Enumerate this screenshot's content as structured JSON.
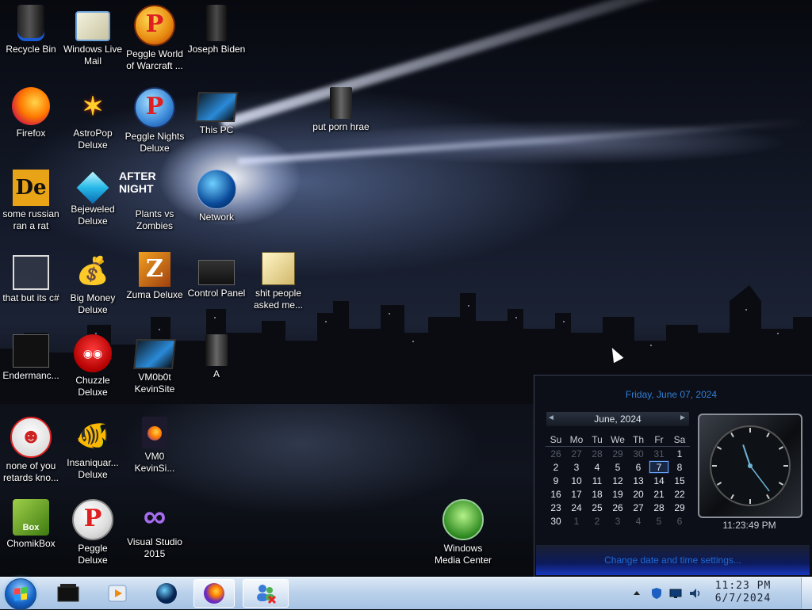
{
  "desktop_icons": [
    {
      "label": "Recycle Bin",
      "icon": "recycle-bin-icon"
    },
    {
      "label": "Windows Live Mail",
      "icon": "mail-icon"
    },
    {
      "label": "Peggle World of Warcraft ...",
      "icon": "peggle-icon"
    },
    {
      "label": "Joseph Biden",
      "icon": "user-folder-icon"
    },
    {
      "label": "Firefox",
      "icon": "firefox-icon"
    },
    {
      "label": "AstroPop Deluxe",
      "icon": "astropop-icon"
    },
    {
      "label": "Peggle Nights Deluxe",
      "icon": "peggle-nights-icon"
    },
    {
      "label": "This PC",
      "icon": "monitor-icon"
    },
    {
      "label": "put porn hrae",
      "icon": "document-icon"
    },
    {
      "label": "some russian ran a rat",
      "icon": "de-app-icon"
    },
    {
      "label": "Bejeweled Deluxe",
      "icon": "gem-icon"
    },
    {
      "label": "Plants vs Zombies",
      "icon": "plants-vs-zombies-icon"
    },
    {
      "label": "AFTER  NIGHT",
      "icon": "after-night-logo"
    },
    {
      "label": "Network",
      "icon": "network-globe-icon"
    },
    {
      "label": "that but its c#",
      "icon": "windows-stack-icon"
    },
    {
      "label": "Big Money Deluxe",
      "icon": "money-bag-icon"
    },
    {
      "label": "Zuma Deluxe",
      "icon": "zuma-icon"
    },
    {
      "label": "Control Panel",
      "icon": "control-panel-icon"
    },
    {
      "label": "shit people asked me...",
      "icon": "folder-icon"
    },
    {
      "label": "Endermanc...",
      "icon": "terminal-icon"
    },
    {
      "label": "Chuzzle Deluxe",
      "icon": "chuzzle-icon"
    },
    {
      "label": "VM0b0t KevinSite",
      "icon": "vm-icon"
    },
    {
      "label": "A",
      "icon": "file-icon"
    },
    {
      "label": "none of you retards kno...",
      "icon": "redhead-icon"
    },
    {
      "label": "Insaniquar... Deluxe",
      "icon": "fish-icon"
    },
    {
      "label": "VM0 KevinSi...",
      "icon": "firefox-document-icon"
    },
    {
      "label": "ChomikBox",
      "icon": "chomikbox-icon"
    },
    {
      "label": "Peggle Deluxe",
      "icon": "peggle-deluxe-icon"
    },
    {
      "label": "Visual Studio 2015",
      "icon": "visual-studio-icon"
    },
    {
      "label": "Windows Media Center",
      "icon": "media-center-icon"
    }
  ],
  "calendar": {
    "date_heading": "Friday, June 07, 2024",
    "month_label": "June, 2024",
    "prev_glyph": "◄",
    "next_glyph": "►",
    "weekdays": [
      "Su",
      "Mo",
      "Tu",
      "We",
      "Th",
      "Fr",
      "Sa"
    ],
    "weeks": [
      [
        "26",
        "27",
        "28",
        "29",
        "30",
        "31",
        "1"
      ],
      [
        "2",
        "3",
        "4",
        "5",
        "6",
        "7",
        "8"
      ],
      [
        "9",
        "10",
        "11",
        "12",
        "13",
        "14",
        "15"
      ],
      [
        "16",
        "17",
        "18",
        "19",
        "20",
        "21",
        "22"
      ],
      [
        "23",
        "24",
        "25",
        "26",
        "27",
        "28",
        "29"
      ],
      [
        "30",
        "1",
        "2",
        "3",
        "4",
        "5",
        "6"
      ]
    ],
    "selected_day": "7",
    "clock_time": "11:23:49 PM",
    "settings_link": "Change date and time settings..."
  },
  "taskbar": {
    "pinned": [
      {
        "name": "taskbar-terminal",
        "icon": "terminal-icon"
      },
      {
        "name": "taskbar-media-player",
        "icon": "media-player-icon"
      },
      {
        "name": "taskbar-globe",
        "icon": "globe-icon"
      },
      {
        "name": "taskbar-firefox",
        "icon": "firefox-icon"
      },
      {
        "name": "taskbar-network-users",
        "icon": "users-icon"
      }
    ],
    "tray_icons": [
      "show-hidden-icons-arrow",
      "shield-icon",
      "monitor-icon",
      "volume-icon"
    ],
    "time": "11:23 PM",
    "date": "6/7/2024"
  },
  "colors": {
    "calendar_accent": "#2f7fd8",
    "taskbar_top": "#dbe8f5",
    "taskbar_bottom": "#a6c3e4"
  }
}
